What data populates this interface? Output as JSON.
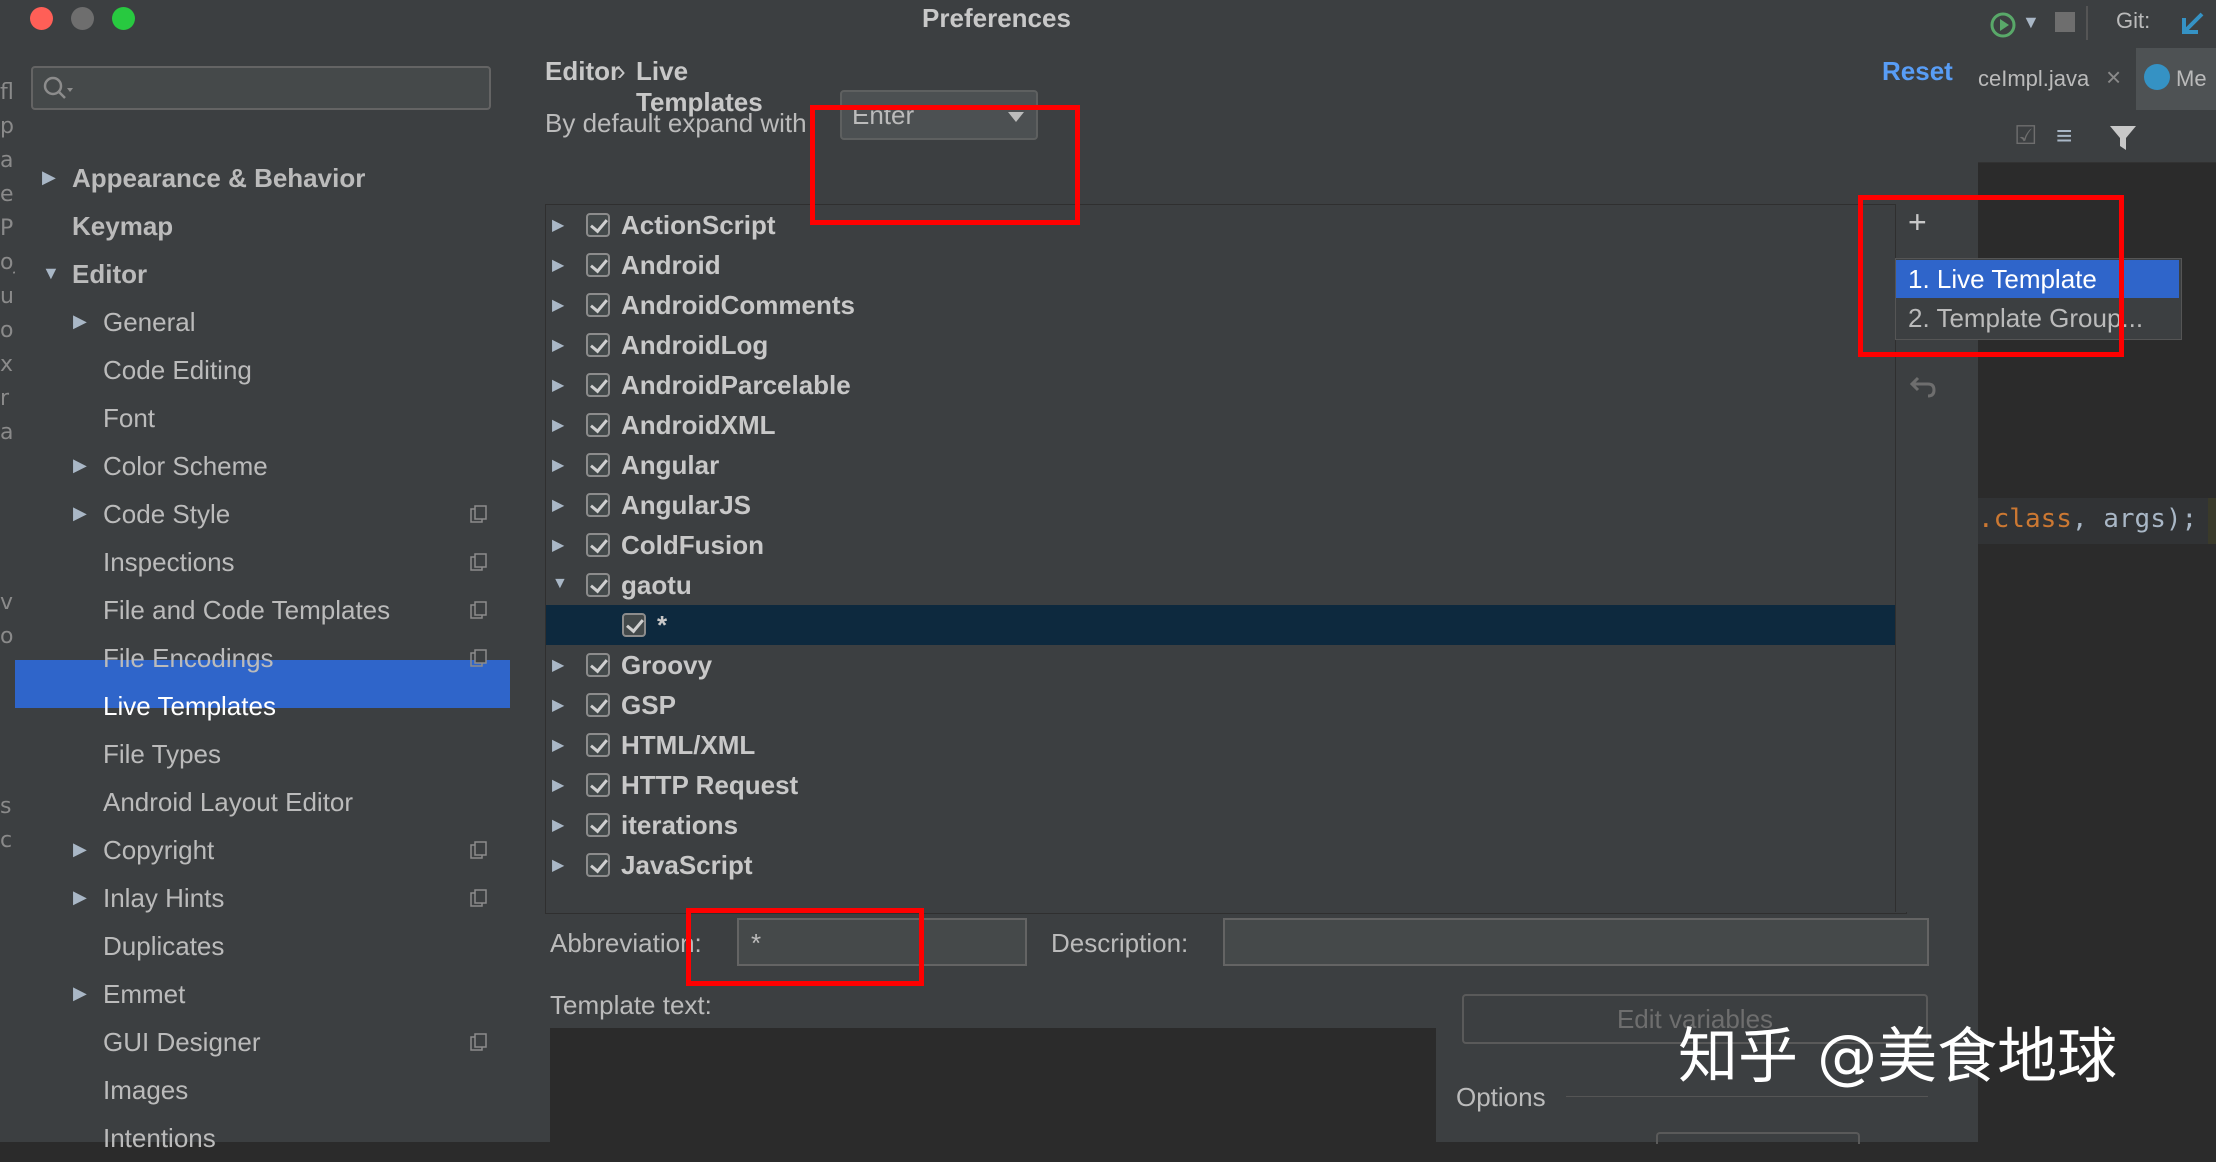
{
  "window": {
    "title": "Preferences"
  },
  "ide_background": {
    "tabs": [
      "ceImpl.java",
      "Me"
    ],
    "git_label": "Git:",
    "code_parts": [
      ".class",
      ", args);"
    ]
  },
  "sidebar": {
    "search_placeholder": "",
    "items": [
      {
        "label": "Appearance & Behavior",
        "level": 0,
        "arrow": "right",
        "bold": true
      },
      {
        "label": "Keymap",
        "level": 0,
        "arrow": "none",
        "bold": true
      },
      {
        "label": "Editor",
        "level": 0,
        "arrow": "down",
        "bold": true
      },
      {
        "label": "General",
        "level": 1,
        "arrow": "right"
      },
      {
        "label": "Code Editing",
        "level": 1,
        "arrow": "none"
      },
      {
        "label": "Font",
        "level": 1,
        "arrow": "none"
      },
      {
        "label": "Color Scheme",
        "level": 1,
        "arrow": "right"
      },
      {
        "label": "Code Style",
        "level": 1,
        "arrow": "right",
        "badge": true
      },
      {
        "label": "Inspections",
        "level": 1,
        "arrow": "none",
        "badge": true
      },
      {
        "label": "File and Code Templates",
        "level": 1,
        "arrow": "none",
        "badge": true
      },
      {
        "label": "File Encodings",
        "level": 1,
        "arrow": "none",
        "badge": true
      },
      {
        "label": "Live Templates",
        "level": 1,
        "arrow": "none",
        "selected": true
      },
      {
        "label": "File Types",
        "level": 1,
        "arrow": "none"
      },
      {
        "label": "Android Layout Editor",
        "level": 1,
        "arrow": "none"
      },
      {
        "label": "Copyright",
        "level": 1,
        "arrow": "right",
        "badge": true
      },
      {
        "label": "Inlay Hints",
        "level": 1,
        "arrow": "right",
        "badge": true
      },
      {
        "label": "Duplicates",
        "level": 1,
        "arrow": "none"
      },
      {
        "label": "Emmet",
        "level": 1,
        "arrow": "right"
      },
      {
        "label": "GUI Designer",
        "level": 1,
        "arrow": "none",
        "badge": true
      },
      {
        "label": "Images",
        "level": 1,
        "arrow": "none"
      },
      {
        "label": "Intentions",
        "level": 1,
        "arrow": "none"
      }
    ]
  },
  "breadcrumb": {
    "parent": "Editor",
    "separator": "›",
    "current": "Live Templates"
  },
  "reset_label": "Reset",
  "expand": {
    "label": "By default expand with",
    "value": "Enter"
  },
  "tree": [
    {
      "label": "ActionScript",
      "expanded": false
    },
    {
      "label": "Android",
      "expanded": false
    },
    {
      "label": "AndroidComments",
      "expanded": false
    },
    {
      "label": "AndroidLog",
      "expanded": false
    },
    {
      "label": "AndroidParcelable",
      "expanded": false
    },
    {
      "label": "AndroidXML",
      "expanded": false
    },
    {
      "label": "Angular",
      "expanded": false
    },
    {
      "label": "AngularJS",
      "expanded": false
    },
    {
      "label": "ColdFusion",
      "expanded": false
    },
    {
      "label": "gaotu",
      "expanded": true
    },
    {
      "label": "*",
      "child": true,
      "selected": true
    },
    {
      "label": "Groovy",
      "expanded": false
    },
    {
      "label": "GSP",
      "expanded": false
    },
    {
      "label": "HTML/XML",
      "expanded": false
    },
    {
      "label": "HTTP Request",
      "expanded": false
    },
    {
      "label": "iterations",
      "expanded": false
    },
    {
      "label": "JavaScript",
      "expanded": false
    }
  ],
  "toolbar": {
    "add_icon": "plus-icon",
    "remove_icon": "minus-icon",
    "undo_icon": "undo-icon"
  },
  "add_popup": {
    "items": [
      "1. Live Template",
      "2. Template Group..."
    ],
    "active_index": 0
  },
  "editor_fields": {
    "abbreviation_label": "Abbreviation:",
    "abbreviation_value": "*",
    "description_label": "Description:",
    "description_value": "",
    "template_text_label": "Template text:",
    "edit_variables_label": "Edit variables",
    "options_label": "Options"
  },
  "watermark": "知乎 @美食地球",
  "colors": {
    "selection": "#2f65ca",
    "tree_selection": "#0d293e",
    "annotation_red": "#ff0000",
    "link_blue": "#589df6"
  }
}
